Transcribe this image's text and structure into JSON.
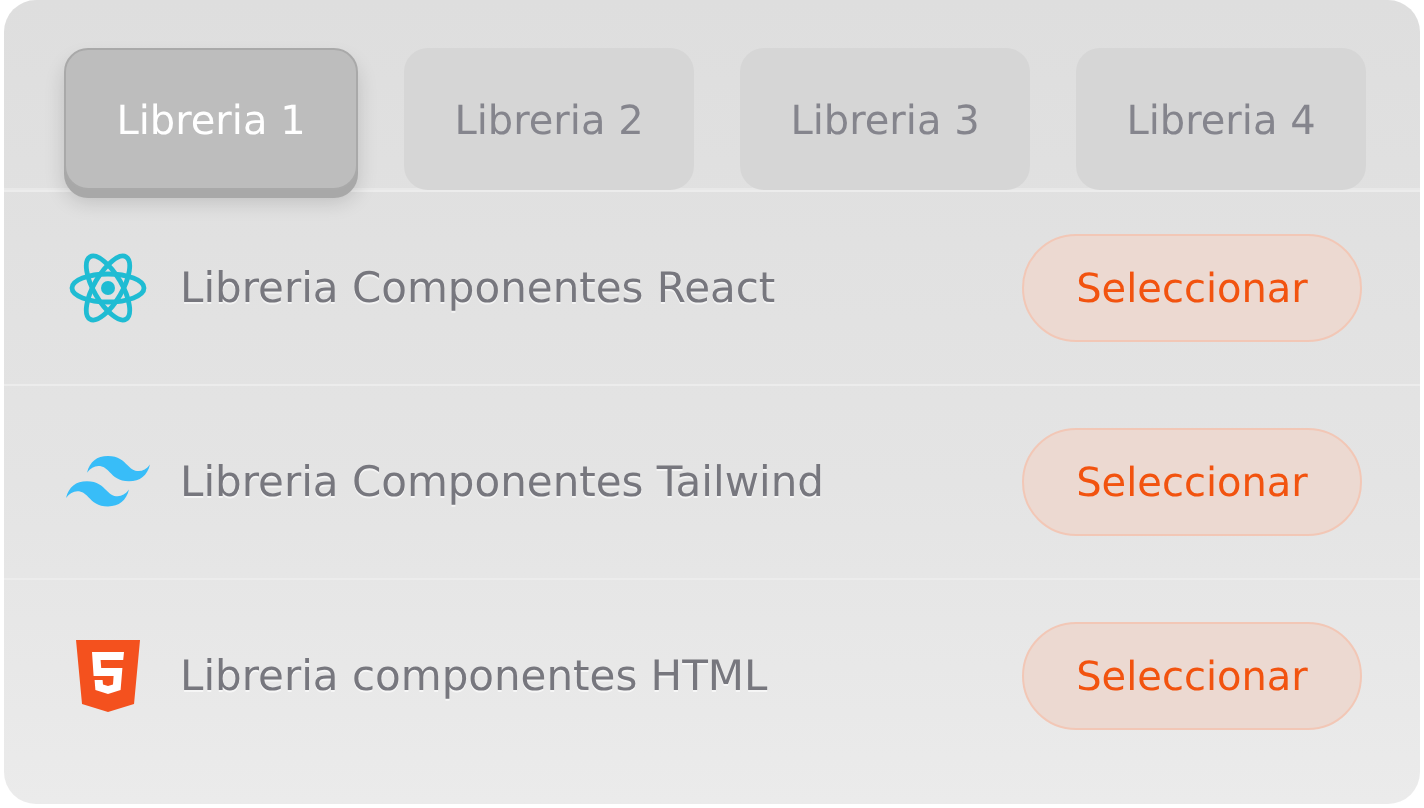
{
  "tabs": [
    {
      "label": "Libreria 1",
      "selected": true
    },
    {
      "label": "Libreria 2",
      "selected": false
    },
    {
      "label": "Libreria 3",
      "selected": false
    },
    {
      "label": "Libreria 4",
      "selected": false
    }
  ],
  "libraries": [
    {
      "kind": "react",
      "name": "Libreria Componentes React",
      "button": "Seleccionar"
    },
    {
      "kind": "tailwind",
      "name": "Libreria Componentes Tailwind",
      "button": "Seleccionar"
    },
    {
      "kind": "html",
      "name": "Libreria componentes HTML",
      "button": "Seleccionar"
    }
  ]
}
